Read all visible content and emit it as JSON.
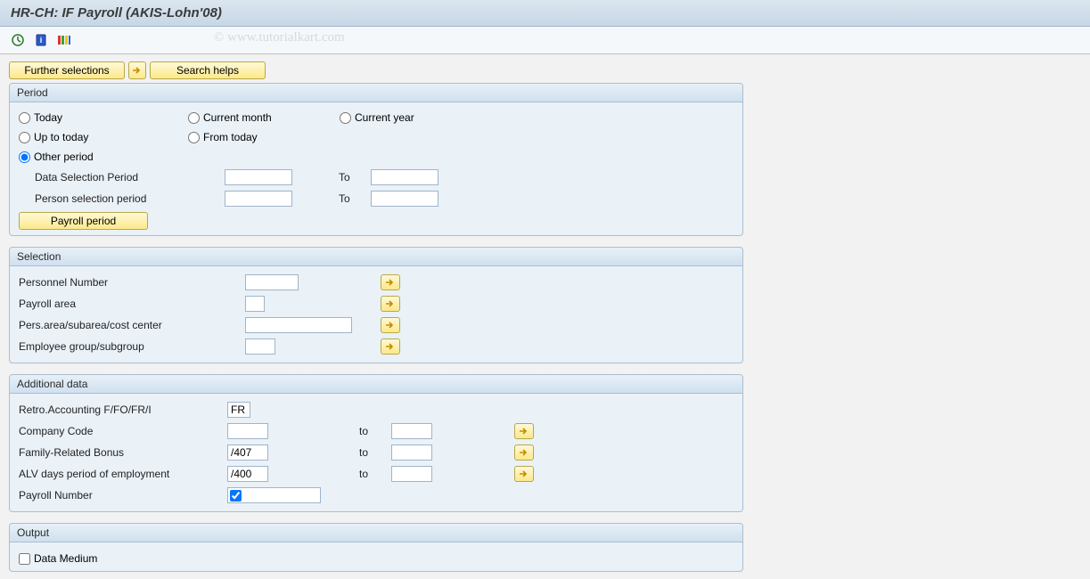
{
  "title": "HR-CH: IF Payroll (AKIS-Lohn'08)",
  "watermark": "© www.tutorialkart.com",
  "toolbar": {
    "execute_icon": "execute",
    "info_icon": "info",
    "variant_icon": "variant"
  },
  "buttons": {
    "further_selections": "Further selections",
    "search_helps": "Search helps",
    "payroll_period": "Payroll period"
  },
  "period": {
    "title": "Period",
    "radios": {
      "today": "Today",
      "current_month": "Current month",
      "current_year": "Current year",
      "up_to_today": "Up to today",
      "from_today": "From today",
      "other_period": "Other period"
    },
    "data_selection_label": "Data Selection Period",
    "person_selection_label": "Person selection period",
    "to_label": "To",
    "data_sel_from": "",
    "data_sel_to": "",
    "person_sel_from": "",
    "person_sel_to": ""
  },
  "selection": {
    "title": "Selection",
    "personnel_number_label": "Personnel Number",
    "payroll_area_label": "Payroll area",
    "pers_area_label": "Pers.area/subarea/cost center",
    "emp_group_label": "Employee group/subgroup",
    "personnel_number": "",
    "payroll_area": "",
    "pers_area": "",
    "emp_group": ""
  },
  "additional": {
    "title": "Additional data",
    "retro_label": "Retro.Accounting F/FO/FR/I",
    "retro_value": "FR",
    "company_code_label": "Company Code",
    "company_code_from": "",
    "company_code_to": "",
    "family_bonus_label": "Family-Related Bonus",
    "family_bonus_from": "/407",
    "family_bonus_to": "",
    "alv_label": "ALV days period of employment",
    "alv_from": "/400",
    "alv_to": "",
    "payroll_number_label": "Payroll Number",
    "payroll_number_checked": true,
    "payroll_number_value": "",
    "to_label": "to"
  },
  "output": {
    "title": "Output",
    "data_medium_label": "Data Medium",
    "data_medium_checked": false
  }
}
